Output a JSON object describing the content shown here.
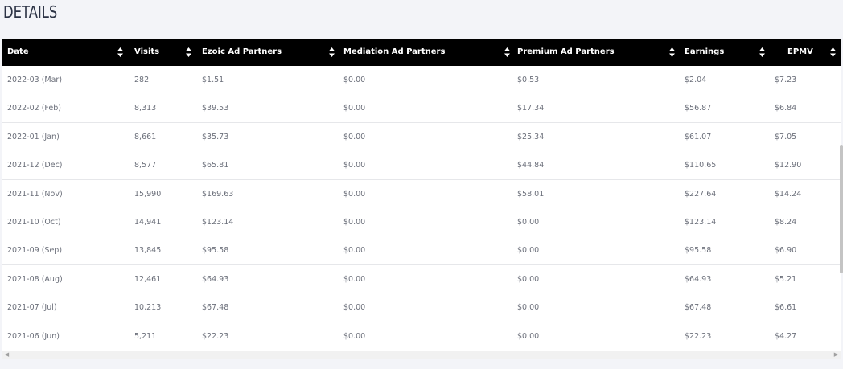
{
  "page": {
    "title": "DETAILS"
  },
  "table": {
    "columns": [
      {
        "key": "date",
        "label": "Date"
      },
      {
        "key": "visits",
        "label": "Visits"
      },
      {
        "key": "ezoic",
        "label": "Ezoic Ad Partners"
      },
      {
        "key": "mediation",
        "label": "Mediation Ad Partners"
      },
      {
        "key": "premium",
        "label": "Premium Ad Partners"
      },
      {
        "key": "earnings",
        "label": "Earnings"
      },
      {
        "key": "epmv",
        "label": "EPMV"
      }
    ],
    "rows": [
      {
        "date": "2022-03 (Mar)",
        "visits": "282",
        "ezoic": "$1.51",
        "mediation": "$0.00",
        "premium": "$0.53",
        "earnings": "$2.04",
        "epmv": "$7.23"
      },
      {
        "date": "2022-02 (Feb)",
        "visits": "8,313",
        "ezoic": "$39.53",
        "mediation": "$0.00",
        "premium": "$17.34",
        "earnings": "$56.87",
        "epmv": "$6.84"
      },
      {
        "date": "2022-01 (Jan)",
        "visits": "8,661",
        "ezoic": "$35.73",
        "mediation": "$0.00",
        "premium": "$25.34",
        "earnings": "$61.07",
        "epmv": "$7.05"
      },
      {
        "date": "2021-12 (Dec)",
        "visits": "8,577",
        "ezoic": "$65.81",
        "mediation": "$0.00",
        "premium": "$44.84",
        "earnings": "$110.65",
        "epmv": "$12.90"
      },
      {
        "date": "2021-11 (Nov)",
        "visits": "15,990",
        "ezoic": "$169.63",
        "mediation": "$0.00",
        "premium": "$58.01",
        "earnings": "$227.64",
        "epmv": "$14.24"
      },
      {
        "date": "2021-10 (Oct)",
        "visits": "14,941",
        "ezoic": "$123.14",
        "mediation": "$0.00",
        "premium": "$0.00",
        "earnings": "$123.14",
        "epmv": "$8.24"
      },
      {
        "date": "2021-09 (Sep)",
        "visits": "13,845",
        "ezoic": "$95.58",
        "mediation": "$0.00",
        "premium": "$0.00",
        "earnings": "$95.58",
        "epmv": "$6.90"
      },
      {
        "date": "2021-08 (Aug)",
        "visits": "12,461",
        "ezoic": "$64.93",
        "mediation": "$0.00",
        "premium": "$0.00",
        "earnings": "$64.93",
        "epmv": "$5.21"
      },
      {
        "date": "2021-07 (Jul)",
        "visits": "10,213",
        "ezoic": "$67.48",
        "mediation": "$0.00",
        "premium": "$0.00",
        "earnings": "$67.48",
        "epmv": "$6.61"
      },
      {
        "date": "2021-06 (Jun)",
        "visits": "5,211",
        "ezoic": "$22.23",
        "mediation": "$0.00",
        "premium": "$0.00",
        "earnings": "$22.23",
        "epmv": "$4.27"
      }
    ]
  },
  "icons": {
    "sort": "sort-updown-icon",
    "scroll_left": "chevron-left-icon",
    "scroll_right": "chevron-right-icon"
  },
  "colors": {
    "header_bg": "#000000",
    "header_text": "#ffffff",
    "cell_text": "#6b6f7a",
    "page_bg": "#f3f4f8"
  }
}
